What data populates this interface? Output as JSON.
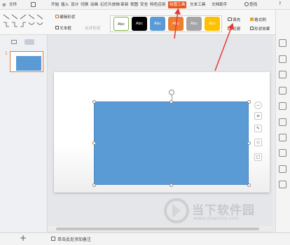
{
  "menubar": {
    "file_label": "文件",
    "items": [
      "开始",
      "插入",
      "设计",
      "切换",
      "动画",
      "幻灯片放映",
      "审阅",
      "视图",
      "安全",
      "特色应用",
      "绘图工具",
      "文本工具",
      "文档助手"
    ],
    "active_item": "绘图工具",
    "search_label": "查找"
  },
  "ribbon": {
    "edit_shape_label": "编辑形状",
    "textbox_label": "文本框",
    "merge_shape_label": "合并形状",
    "style_sample_text": "Abc",
    "style_colors": [
      "#ffffff",
      "#000000",
      "#5b9bd5",
      "#ed7d31",
      "#a5a5a5",
      "#ffc000"
    ],
    "fill_label": "填充",
    "outline_label": "轮廓",
    "format_painter_label": "格式刷",
    "shape_effects_label": "形状效果"
  },
  "slides_panel": {
    "slide_number": "1"
  },
  "bottombar": {
    "notes_placeholder": "单击此处添加备注"
  },
  "colors": {
    "shape_fill": "#5b9bd5",
    "accent": "#e8581c",
    "arrow": "#e53935"
  },
  "watermark": {
    "text": "当下软件园",
    "url": "www.downxia.com"
  }
}
